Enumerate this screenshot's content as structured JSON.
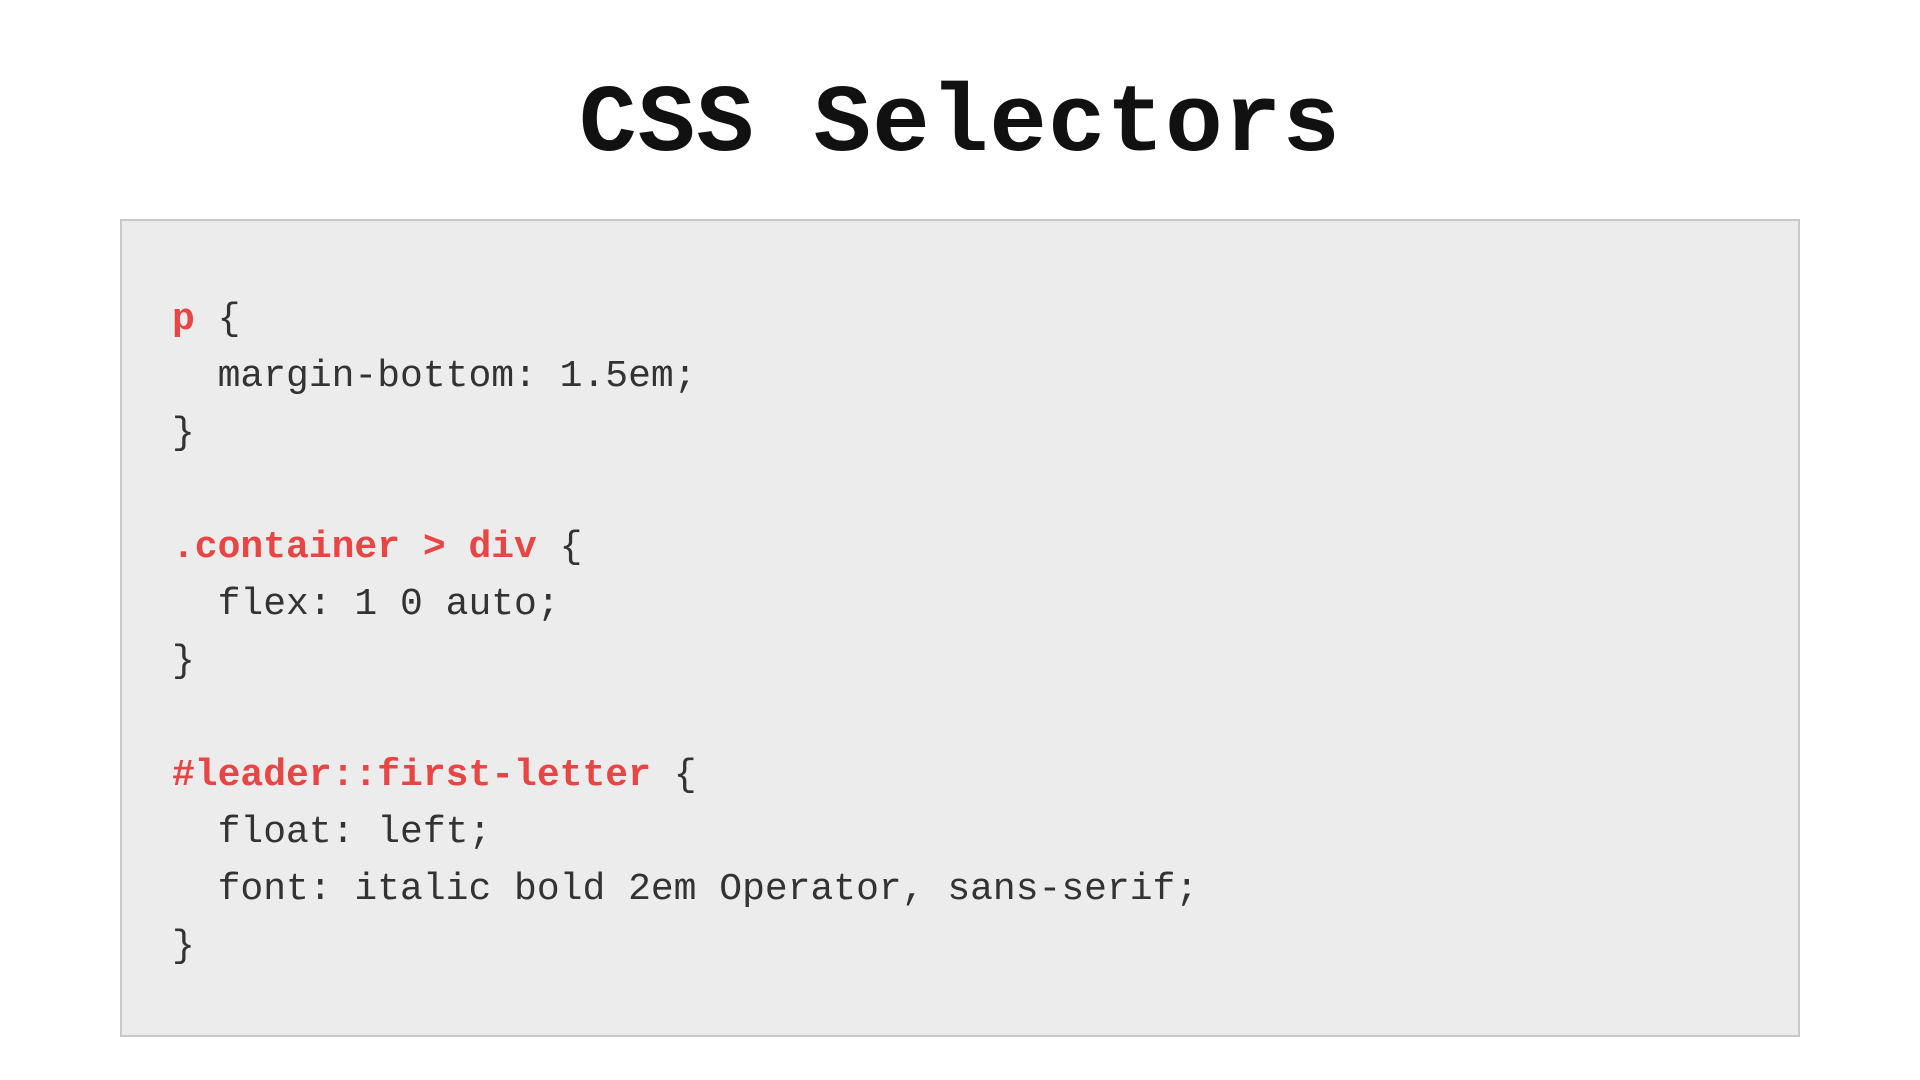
{
  "title": "CSS Selectors",
  "code": {
    "rule1": {
      "selector": "p",
      "open": " {",
      "body": "  margin-bottom: 1.5em;",
      "close": "}"
    },
    "rule2": {
      "selector": ".container > div",
      "open": " {",
      "body": "  flex: 1 0 auto;",
      "close": "}"
    },
    "rule3": {
      "selector": "#leader::first-letter",
      "open": " {",
      "body1": "  float: left;",
      "body2": "  font: italic bold 2em Operator, sans-serif;",
      "close": "}"
    }
  }
}
